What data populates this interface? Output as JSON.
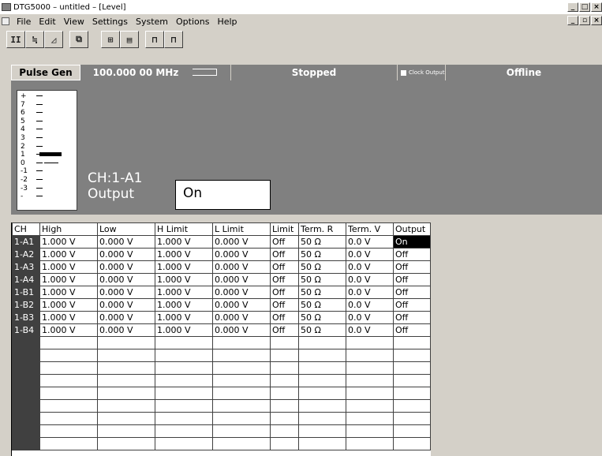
{
  "window": {
    "title": "DTG5000 – untitled – [Level]",
    "controls": [
      "_",
      "□",
      "×"
    ],
    "mdi_controls": [
      "_",
      "▫",
      "×"
    ]
  },
  "menu": [
    "File",
    "Edit",
    "View",
    "Settings",
    "System",
    "Options",
    "Help"
  ],
  "toolbar": {
    "buttons": [
      {
        "icon": "level-view-icon",
        "glyph": "II"
      },
      {
        "icon": "timing-view-icon",
        "glyph": "≒"
      },
      {
        "icon": "waveform-view-icon",
        "glyph": "◿"
      },
      {
        "icon": "settings-view-icon",
        "glyph": "⧉"
      },
      {
        "icon": "channel-assign-icon",
        "glyph": "⊞"
      },
      {
        "icon": "table-view-icon",
        "glyph": "▤"
      },
      {
        "icon": "pulse-icon",
        "glyph": "⊓"
      },
      {
        "icon": "edge-icon",
        "glyph": "⊓"
      }
    ]
  },
  "status": {
    "mode": "Pulse Gen",
    "frequency": "100.000 00 MHz",
    "run_state": "Stopped",
    "clock_output": "Clock Output",
    "connection": "Offline"
  },
  "level_gauge": {
    "labels": [
      "+",
      "7",
      "6",
      "5",
      "4",
      "3",
      "2",
      "1",
      "0",
      "-1",
      "-2",
      "-3",
      "-"
    ],
    "high": 1.0,
    "low": 0.0
  },
  "detail": {
    "channel": "CH:1-A1",
    "field": "Output",
    "value": "On"
  },
  "table": {
    "columns": [
      "CH",
      "High",
      "Low",
      "H Limit",
      "L Limit",
      "Limit",
      "Term. R",
      "Term. V",
      "Output"
    ],
    "rows": [
      [
        "1-A1",
        "1.000 V",
        "0.000 V",
        "1.000 V",
        "0.000 V",
        "Off",
        "50 Ω",
        "0.0 V",
        "On"
      ],
      [
        "1-A2",
        "1.000 V",
        "0.000 V",
        "1.000 V",
        "0.000 V",
        "Off",
        "50 Ω",
        "0.0 V",
        "Off"
      ],
      [
        "1-A3",
        "1.000 V",
        "0.000 V",
        "1.000 V",
        "0.000 V",
        "Off",
        "50 Ω",
        "0.0 V",
        "Off"
      ],
      [
        "1-A4",
        "1.000 V",
        "0.000 V",
        "1.000 V",
        "0.000 V",
        "Off",
        "50 Ω",
        "0.0 V",
        "Off"
      ],
      [
        "1-B1",
        "1.000 V",
        "0.000 V",
        "1.000 V",
        "0.000 V",
        "Off",
        "50 Ω",
        "0.0 V",
        "Off"
      ],
      [
        "1-B2",
        "1.000 V",
        "0.000 V",
        "1.000 V",
        "0.000 V",
        "Off",
        "50 Ω",
        "0.0 V",
        "Off"
      ],
      [
        "1-B3",
        "1.000 V",
        "0.000 V",
        "1.000 V",
        "0.000 V",
        "Off",
        "50 Ω",
        "0.0 V",
        "Off"
      ],
      [
        "1-B4",
        "1.000 V",
        "0.000 V",
        "1.000 V",
        "0.000 V",
        "Off",
        "50 Ω",
        "0.0 V",
        "Off"
      ]
    ],
    "selected": {
      "row": 0,
      "col": 8
    },
    "empty_rows": 9
  }
}
